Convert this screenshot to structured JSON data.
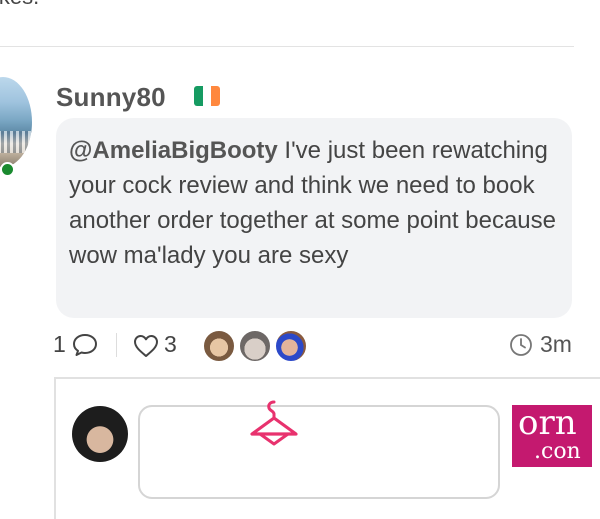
{
  "previous_comment": {
    "tail_text": "ikes."
  },
  "comment": {
    "username": "Sunny80",
    "flag_colors": [
      "#169b62",
      "#ffffff",
      "#ff883e"
    ],
    "mention": "@AmeliaBigBooty",
    "body": " I've just been rewatching your cock review and think we need to book another order together at some point because wow ma'lady you are sexy",
    "reply_count": "1",
    "like_count": "3",
    "time": "3m",
    "online_color": "#1a8a2f"
  },
  "ad": {
    "logo_line1": "orn",
    "logo_line2": ".con",
    "brand_color": "#c4196f"
  },
  "icons": {
    "comment": "comment-bubble-icon",
    "like": "heart-icon",
    "time": "clock-icon",
    "hanger": "hanger-icon"
  }
}
